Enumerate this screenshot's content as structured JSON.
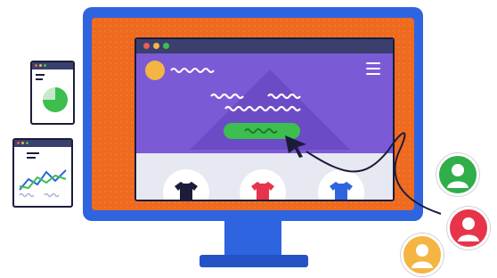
{
  "illustration": {
    "colors": {
      "monitor": "#2f64e0",
      "bezel": "#ee6a1f",
      "hero": "#7b5ad6",
      "cta": "#3cbf4f",
      "window_bar": "#3a3f6e"
    },
    "browser": {
      "window_dots": [
        "#ef5a5a",
        "#f5b543",
        "#3cbf4f"
      ],
      "menu_icon": "hamburger-icon",
      "logo_icon": "circle-logo-icon"
    },
    "products": [
      {
        "icon": "tshirt-icon",
        "color": "#1c1c3a"
      },
      {
        "icon": "tshirt-icon",
        "color": "#e8344a"
      },
      {
        "icon": "tshirt-icon",
        "color": "#2f64e0"
      }
    ],
    "pie_widget": {
      "share": 0.75,
      "color": "#3cbf4f"
    },
    "users": [
      {
        "icon": "user-icon",
        "color": "#2fae4a"
      },
      {
        "icon": "user-icon",
        "color": "#e8344a"
      },
      {
        "icon": "user-icon",
        "color": "#f5b543"
      }
    ]
  }
}
